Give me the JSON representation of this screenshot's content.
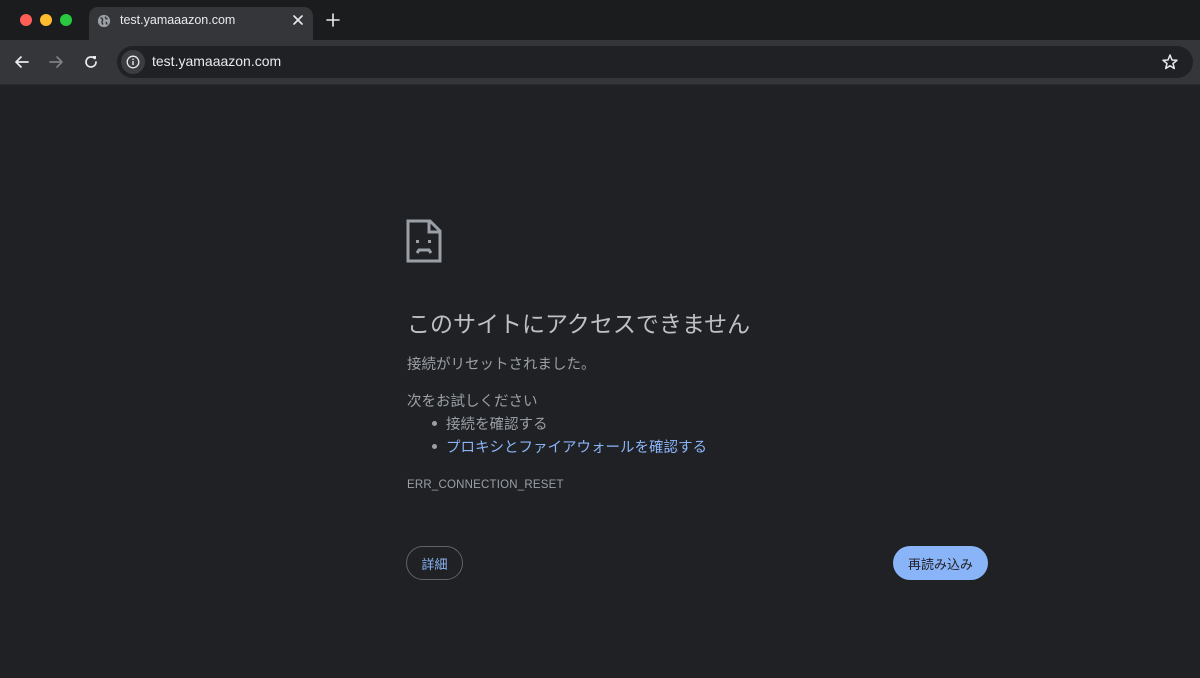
{
  "tab": {
    "title": "test.yamaaazon.com",
    "favicon": "globe-icon"
  },
  "toolbar": {
    "url": "test.yamaaazon.com",
    "icons": [
      "back-arrow-icon",
      "forward-arrow-icon",
      "reload-icon",
      "info-icon",
      "star-icon"
    ]
  },
  "error": {
    "icon": "sad-document-icon",
    "heading": "このサイトにアクセスできません",
    "description": "接続がリセットされました。",
    "try_label": "次をお試しください",
    "suggestions": [
      {
        "text": "接続を確認する",
        "is_link": false
      },
      {
        "text": "プロキシとファイアウォールを確認する",
        "is_link": true
      }
    ],
    "code": "ERR_CONNECTION_RESET",
    "details_label": "詳細",
    "reload_label": "再読み込み"
  },
  "colors": {
    "background": "#202124",
    "toolbar": "#35363a",
    "link": "#8ab4f8",
    "text": "#9aa0a6",
    "heading": "#bdc1c6",
    "traffic_red": "#ff5f57",
    "traffic_yellow": "#febc2e",
    "traffic_green": "#28c840"
  }
}
